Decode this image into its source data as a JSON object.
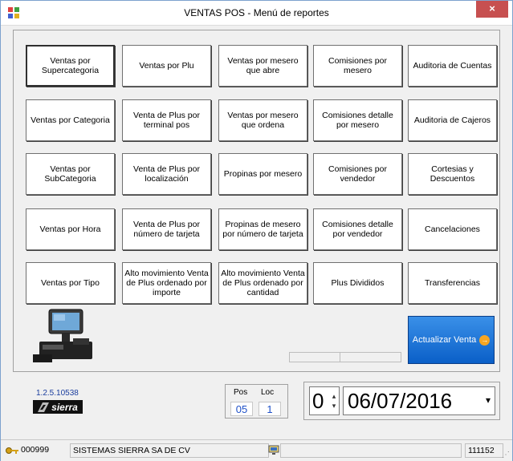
{
  "window": {
    "title": "VENTAS POS - Menú de reportes",
    "close_label": "×"
  },
  "reports": [
    [
      "Ventas por Supercategoria",
      "Ventas por Plu",
      "Ventas por mesero que abre",
      "Comisiones por mesero",
      "Auditoria de Cuentas"
    ],
    [
      "Ventas por Categoria",
      "Venta de Plus por terminal pos",
      "Ventas por mesero que ordena",
      "Comisiones detalle por mesero",
      "Auditoria de Cajeros"
    ],
    [
      "Ventas por SubCategoria",
      "Venta de Plus por localización",
      "Propinas por mesero",
      "Comisiones por vendedor",
      "Cortesias y Descuentos"
    ],
    [
      "Ventas por Hora",
      "Venta de Plus por número de tarjeta",
      "Propinas de mesero por número de tarjeta",
      "Comisiones detalle por vendedor",
      "Cancelaciones"
    ],
    [
      "Ventas por Tipo",
      "Alto movimiento Venta de Plus ordenado por importe",
      "Alto movimiento Venta de Plus ordenado por cantidad",
      "Plus Divididos",
      "Transferencias"
    ]
  ],
  "actualizar": {
    "label": "Actualizar Venta",
    "icon": "arrow-right-circle-icon",
    "color": "#1a6fd8"
  },
  "version": "1.2.5.10538",
  "logo_text": "sierra",
  "pos_loc": {
    "pos_label": "Pos",
    "loc_label": "Loc",
    "pos_value": "05",
    "loc_value": "1"
  },
  "date_picker": {
    "spin_value": "0",
    "date": "06/07/2016"
  },
  "statusbar": {
    "code": "000999",
    "company": "SISTEMAS SIERRA SA DE CV",
    "right_value": "111152"
  }
}
